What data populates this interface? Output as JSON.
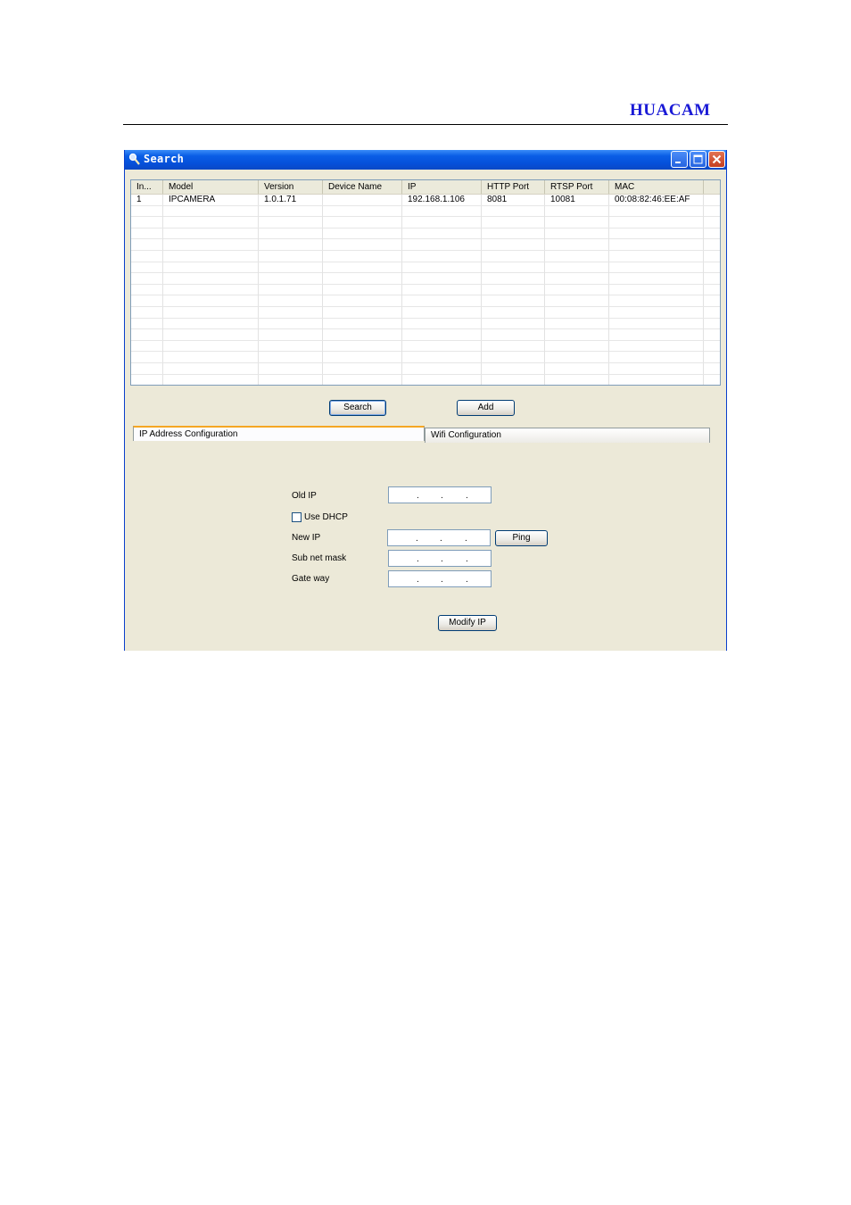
{
  "header": {
    "brand": "HUACAM"
  },
  "window": {
    "title": "Search",
    "icon": "search-icon",
    "controls": [
      "minimize-icon",
      "maximize-icon",
      "close-icon"
    ]
  },
  "table": {
    "columns": [
      "In...",
      "Model",
      "Version",
      "Device Name",
      "IP",
      "HTTP Port",
      "RTSP Port",
      "MAC"
    ],
    "rows": [
      [
        "1",
        "IPCAMERA",
        "1.0.1.71",
        "",
        "192.168.1.106",
        "8081",
        "10081",
        "00:08:82:46:EE:AF"
      ]
    ]
  },
  "buttons": {
    "search": "Search",
    "add": "Add",
    "ping": "Ping",
    "modify_ip": "Modify IP"
  },
  "tabs": [
    "IP Address Configuration",
    "Wifi Configuration"
  ],
  "ip_config": {
    "old_ip_label": "Old IP",
    "use_dhcp_label": "Use DHCP",
    "use_dhcp_checked": false,
    "new_ip_label": "New IP",
    "subnet_label": "Sub net mask",
    "gateway_label": "Gate way",
    "ip_separator": "."
  }
}
